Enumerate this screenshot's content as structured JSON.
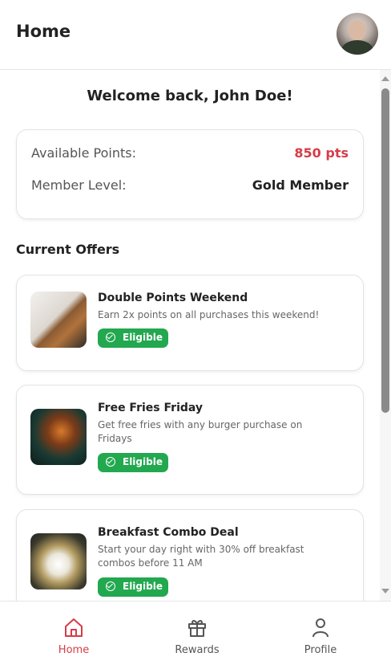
{
  "header": {
    "title": "Home"
  },
  "welcome": "Welcome back, John Doe!",
  "points_card": {
    "available_label": "Available Points:",
    "available_value": "850 pts",
    "level_label": "Member Level:",
    "level_value": "Gold Member"
  },
  "section_title": "Current Offers",
  "offers": [
    {
      "title": "Double Points Weekend",
      "description": "Earn 2x points on all purchases this weekend!",
      "status": "Eligible"
    },
    {
      "title": "Free Fries Friday",
      "description": "Get free fries with any burger purchase on Fridays",
      "status": "Eligible"
    },
    {
      "title": "Breakfast Combo Deal",
      "description": "Start your day right with 30% off breakfast combos before 11 AM",
      "status": "Eligible"
    }
  ],
  "nav": {
    "items": [
      {
        "label": "Home",
        "icon": "home-icon"
      },
      {
        "label": "Rewards",
        "icon": "gift-icon"
      },
      {
        "label": "Profile",
        "icon": "user-icon"
      }
    ],
    "active": "Home"
  },
  "colors": {
    "accent": "#d63c48",
    "eligible": "#22a84f"
  }
}
